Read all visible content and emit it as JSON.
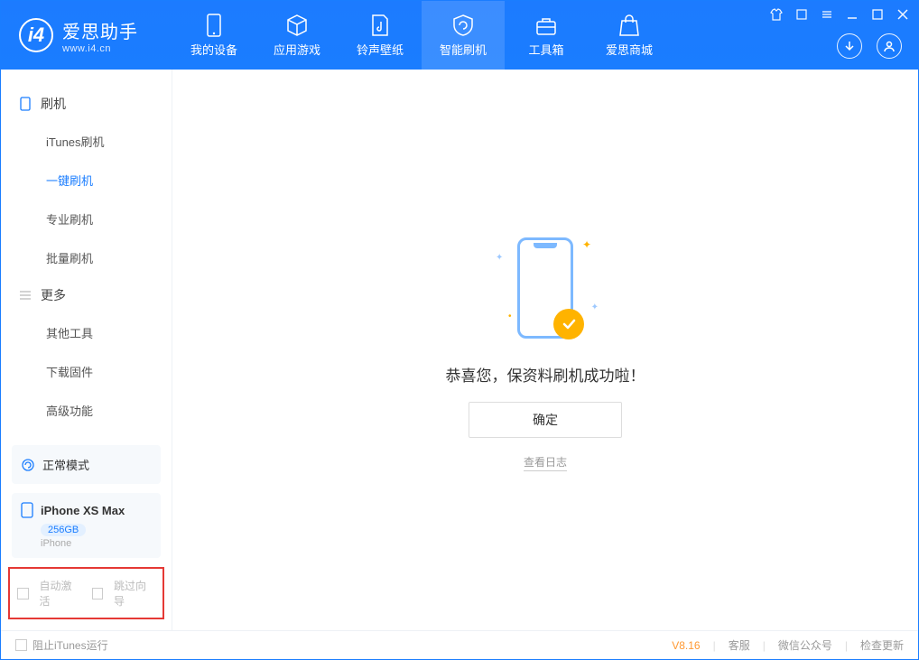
{
  "app": {
    "name_zh": "爱思助手",
    "name_en": "www.i4.cn"
  },
  "nav": {
    "items": [
      {
        "label": "我的设备"
      },
      {
        "label": "应用游戏"
      },
      {
        "label": "铃声壁纸"
      },
      {
        "label": "智能刷机"
      },
      {
        "label": "工具箱"
      },
      {
        "label": "爱思商城"
      }
    ],
    "active_index": 3
  },
  "sidebar": {
    "group1_label": "刷机",
    "group1_items": [
      "iTunes刷机",
      "一键刷机",
      "专业刷机",
      "批量刷机"
    ],
    "group1_active_index": 1,
    "group2_label": "更多",
    "group2_items": [
      "其他工具",
      "下载固件",
      "高级功能"
    ],
    "status_label": "正常模式",
    "device": {
      "name": "iPhone XS Max",
      "capacity": "256GB",
      "type": "iPhone"
    },
    "check_auto_activate": "自动激活",
    "check_skip_guide": "跳过向导"
  },
  "main": {
    "success_text": "恭喜您，保资料刷机成功啦！",
    "ok_label": "确定",
    "view_log_label": "查看日志"
  },
  "footer": {
    "block_itunes": "阻止iTunes运行",
    "version": "V8.16",
    "links": [
      "客服",
      "微信公众号",
      "检查更新"
    ]
  }
}
